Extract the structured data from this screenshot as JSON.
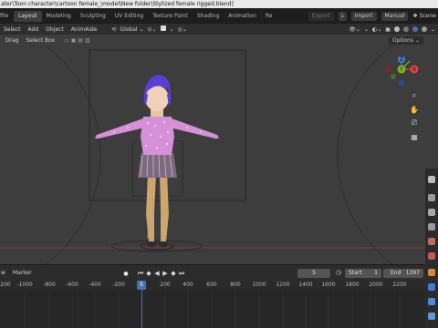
{
  "window": {
    "title": "ater\\Toon character\\cartoon female_\\model\\New folder\\Stylized female rigged.blend]"
  },
  "workspace_tabs": [
    {
      "label": "file",
      "active": false
    },
    {
      "label": "Layout",
      "active": true
    },
    {
      "label": "Modeling",
      "active": false
    },
    {
      "label": "Sculpting",
      "active": false
    },
    {
      "label": "UV Editing",
      "active": false
    },
    {
      "label": "Texture Paint",
      "active": false
    },
    {
      "label": "Shading",
      "active": false
    },
    {
      "label": "Animation",
      "active": false
    },
    {
      "label": "Re",
      "active": false
    }
  ],
  "topbar_right": {
    "export": "Export",
    "import": "Import",
    "manual": "Manual",
    "scene": "Scene"
  },
  "viewport_header": {
    "items": [
      "Select",
      "Add",
      "Object",
      "AnimAide"
    ],
    "orientation": "Global"
  },
  "tool_header": {
    "drag_label": "Drag",
    "select_mode": "Select Box",
    "options": "Options"
  },
  "timeline": {
    "view_label": "w",
    "marker_label": "Marker",
    "current_frame": "5",
    "start_label": "Start",
    "start_value": "1",
    "end_label": "End",
    "end_value": "1397",
    "ruler_ticks": [
      "-1200",
      "-1000",
      "-800",
      "-600",
      "-400",
      "-200",
      "200",
      "400",
      "600",
      "800",
      "1000",
      "1200",
      "1400",
      "1600",
      "1800",
      "2000",
      "2200"
    ],
    "ruler_current": "5"
  },
  "gizmo": {
    "x_label": "X",
    "y_label": "Y",
    "z_label": "Z"
  },
  "colors": {
    "accent": "#4772b3",
    "axis_x": "#e0413f",
    "axis_y": "#7bb628",
    "axis_z": "#4a78d6",
    "hair": "#5a3fd6",
    "outfit": "#d690d8"
  },
  "icons": [
    "cursor-icon",
    "move-icon",
    "rotate-icon",
    "scale-icon",
    "transform-icon",
    "annotate-icon",
    "measure-icon",
    "zoom-icon",
    "hand-icon",
    "camera-icon",
    "grid-icon",
    "play-icon",
    "record-icon",
    "jump-start-icon",
    "jump-end-icon",
    "clock-icon"
  ]
}
